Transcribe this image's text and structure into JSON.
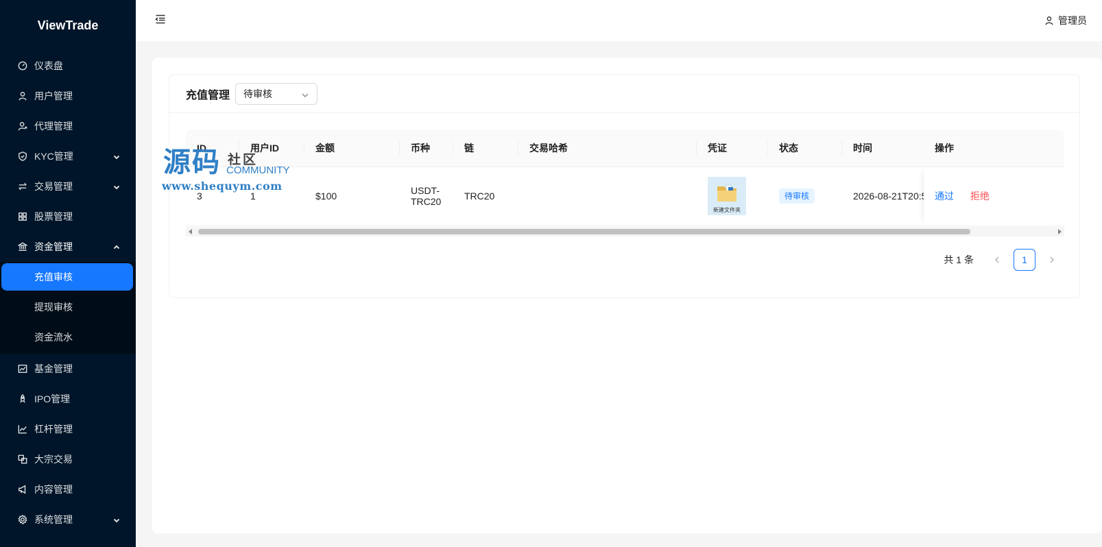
{
  "app": {
    "logo": "ViewTrade"
  },
  "header": {
    "user_label": "管理员"
  },
  "sidebar": {
    "items": [
      {
        "label": "仪表盘",
        "icon": "dashboard-icon"
      },
      {
        "label": "用户管理",
        "icon": "user-icon"
      },
      {
        "label": "代理管理",
        "icon": "agent-icon"
      },
      {
        "label": "KYC管理",
        "icon": "shield-icon",
        "expandable": true
      },
      {
        "label": "交易管理",
        "icon": "swap-icon",
        "expandable": true
      },
      {
        "label": "股票管理",
        "icon": "grid-icon"
      },
      {
        "label": "资金管理",
        "icon": "bank-icon",
        "expanded": true
      },
      {
        "label": "基金管理",
        "icon": "fund-chart-icon"
      },
      {
        "label": "IPO管理",
        "icon": "rocket-icon"
      },
      {
        "label": "杠杆管理",
        "icon": "line-chart-icon"
      },
      {
        "label": "大宗交易",
        "icon": "block-icon"
      },
      {
        "label": "内容管理",
        "icon": "megaphone-icon"
      },
      {
        "label": "系统管理",
        "icon": "gear-icon",
        "expandable": true
      }
    ],
    "fund_submenu": [
      {
        "label": "充值审核",
        "active": true
      },
      {
        "label": "提现审核"
      },
      {
        "label": "资金流水"
      }
    ]
  },
  "page": {
    "title": "充值管理",
    "status_filter": "待审核"
  },
  "table": {
    "columns": [
      "ID",
      "用户ID",
      "金额",
      "币种",
      "链",
      "交易哈希",
      "凭证",
      "状态",
      "时间",
      "操作"
    ],
    "rows": [
      {
        "id": "3",
        "user_id": "1",
        "amount": "$100",
        "currency_line1": "USDT-",
        "currency_line2": "TRC20",
        "chain": "TRC20",
        "tx_hash": "",
        "voucher_caption": "新建文件夹",
        "status": "待审核",
        "time": "2026-08-21T20:5",
        "action_pass": "通过",
        "action_reject": "拒绝"
      }
    ]
  },
  "pagination": {
    "total_text": "共 1 条",
    "current_page": "1"
  },
  "watermark": {
    "main": "源码",
    "side": "社区",
    "community": "COMMUNITY",
    "url": "www.shequym.com"
  },
  "colors": {
    "sidebar_bg": "#001529",
    "primary": "#1677ff",
    "danger": "#ff4d4f"
  }
}
